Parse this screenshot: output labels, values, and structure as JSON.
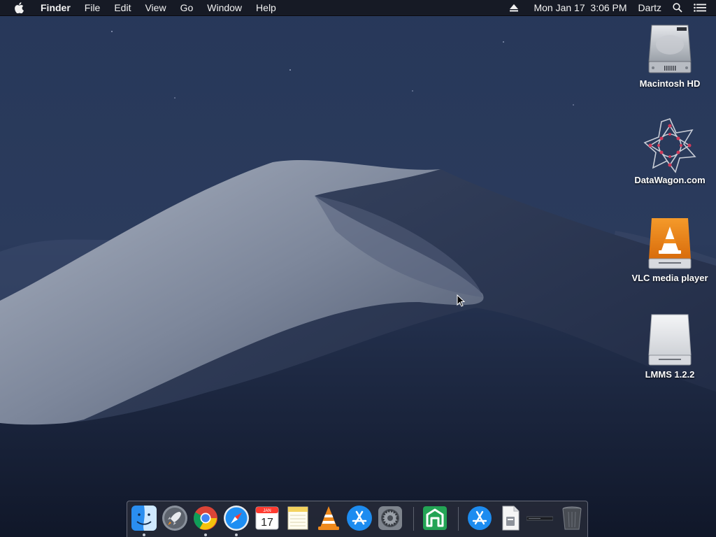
{
  "menubar": {
    "app_name": "Finder",
    "menus": [
      "File",
      "Edit",
      "View",
      "Go",
      "Window",
      "Help"
    ],
    "clock": "Mon Jan 17  3:06 PM",
    "user": "Dartz"
  },
  "desktop_icons": [
    {
      "label": "Macintosh HD",
      "icon": "hard-drive-icon"
    },
    {
      "label": "DataWagon.com",
      "icon": "datawagon-icon"
    },
    {
      "label": "VLC media player",
      "icon": "vlc-disk-icon"
    },
    {
      "label": "LMMS 1.2.2",
      "icon": "external-disk-icon"
    }
  ],
  "dock": {
    "calendar_month": "JAN",
    "calendar_day": "17",
    "apps": [
      "finder-icon",
      "launchpad-icon",
      "chrome-icon",
      "safari-icon",
      "calendar-icon",
      "notes-icon",
      "vlc-icon",
      "app-store-icon",
      "system-preferences-icon",
      "green-app-icon",
      "app-store-download-icon",
      "document-icon",
      "stack-icon",
      "trash-icon"
    ]
  },
  "colors": {
    "menubar": "#14161e",
    "sky": "#1e2c49",
    "dune": "#8e97a8",
    "vlc_orange": "#f08a1c"
  }
}
